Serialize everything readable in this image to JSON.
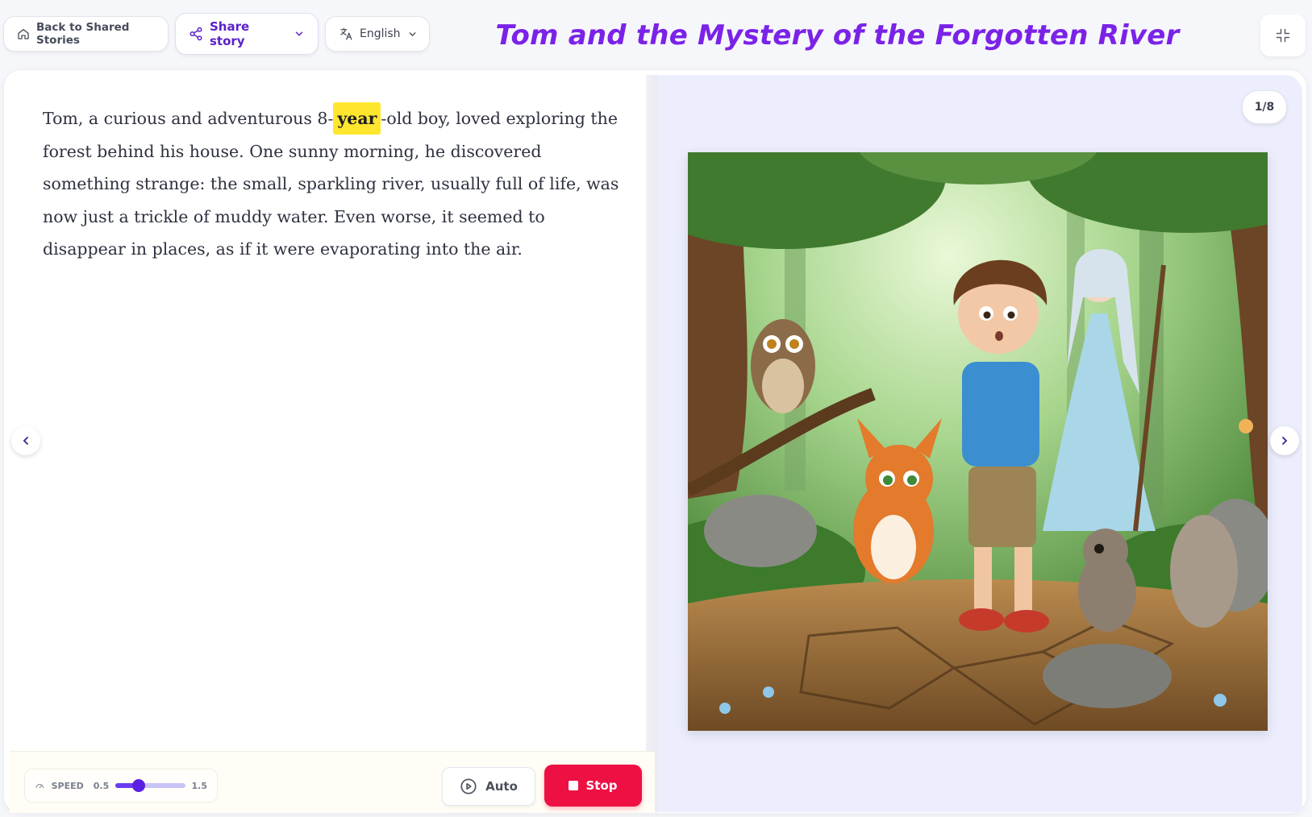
{
  "header": {
    "back_label": "Back to Shared Stories",
    "share_label": "Share story",
    "language": "English",
    "title": "Tom and the Mystery of the Forgotten River"
  },
  "story": {
    "before": "Tom, a curious and adventurous 8-",
    "highlight": "year",
    "after": "-old boy, loved exploring the forest behind his house. One sunny morning, he discovered something strange: the small, sparkling river, usually full of life, was now just a trickle of muddy water. Even worse, it seemed to disappear in places, as if it were evaporating into the air."
  },
  "page_indicator": "1/8",
  "controls": {
    "speed_label": "SPEED",
    "speed_min": "0.5",
    "speed_max": "1.5",
    "speed_level_fraction": 0.33,
    "auto_label": "Auto",
    "stop_label": "Stop"
  },
  "colors": {
    "accent_purple": "#7b22e8",
    "highlight_yellow": "#ffe62e",
    "stop_red": "#ee1043"
  },
  "icons": [
    "home-icon",
    "share-icon",
    "chevron-down-icon",
    "translate-icon",
    "collapse-icon",
    "chevron-left-icon",
    "chevron-right-icon",
    "gauge-icon",
    "play-circle-icon",
    "stop-icon"
  ]
}
